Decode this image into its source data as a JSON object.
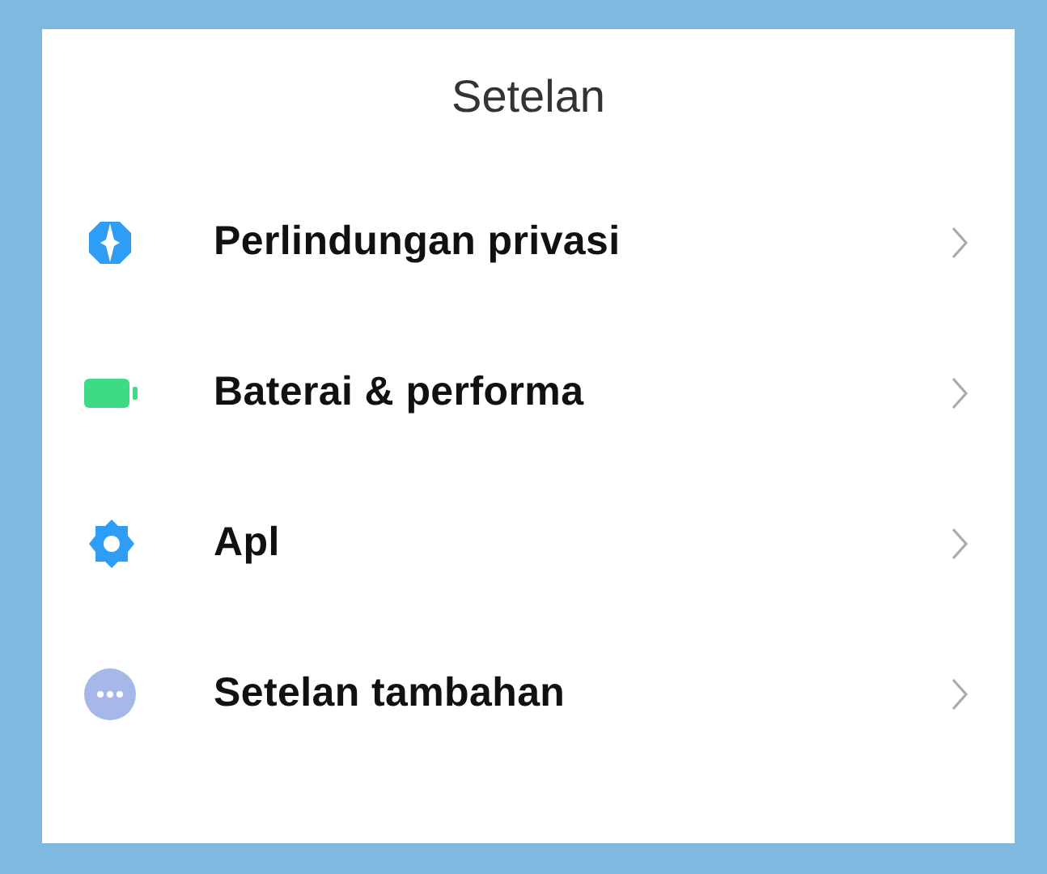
{
  "title": "Setelan",
  "items": [
    {
      "kind": "shield",
      "label": "Perlindungan privasi"
    },
    {
      "kind": "battery",
      "label": "Baterai & performa"
    },
    {
      "kind": "gear",
      "label": "Apl"
    },
    {
      "kind": "more",
      "label": "Setelan tambahan"
    }
  ]
}
